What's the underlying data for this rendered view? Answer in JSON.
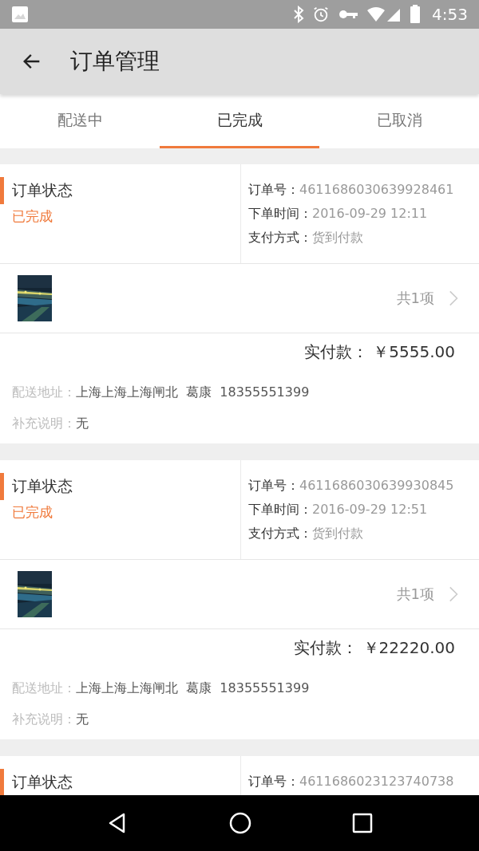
{
  "status_bar": {
    "time": "4:53"
  },
  "app_bar": {
    "title": "订单管理"
  },
  "tabs": [
    {
      "label": "配送中",
      "selected": false
    },
    {
      "label": "已完成",
      "selected": true
    },
    {
      "label": "已取消",
      "selected": false
    }
  ],
  "orders": [
    {
      "status_label": "订单状态",
      "status": "已完成",
      "order_no_label": "订单号：",
      "order_no": "4611686030639928461",
      "time_label": "下单时间：",
      "time": "2016-09-29 12:11",
      "payment_label": "支付方式：",
      "payment": "货到付款",
      "count": "共1项",
      "total_label": "实付款：",
      "total": "￥5555.00",
      "address_label": "配送地址：",
      "address": "上海上海上海闸北",
      "name": "葛康",
      "phone": "18355551399",
      "note_label": "补充说明：",
      "note": "无"
    },
    {
      "status_label": "订单状态",
      "status": "已完成",
      "order_no_label": "订单号：",
      "order_no": "4611686030639930845",
      "time_label": "下单时间：",
      "time": "2016-09-29 12:51",
      "payment_label": "支付方式：",
      "payment": "货到付款",
      "count": "共1项",
      "total_label": "实付款：",
      "total": "￥22220.00",
      "address_label": "配送地址：",
      "address": "上海上海上海闸北",
      "name": "葛康",
      "phone": "18355551399",
      "note_label": "补充说明：",
      "note": "无"
    },
    {
      "status_label": "订单状态",
      "order_no_label": "订单号：",
      "order_no": "4611686023123740738"
    }
  ]
}
